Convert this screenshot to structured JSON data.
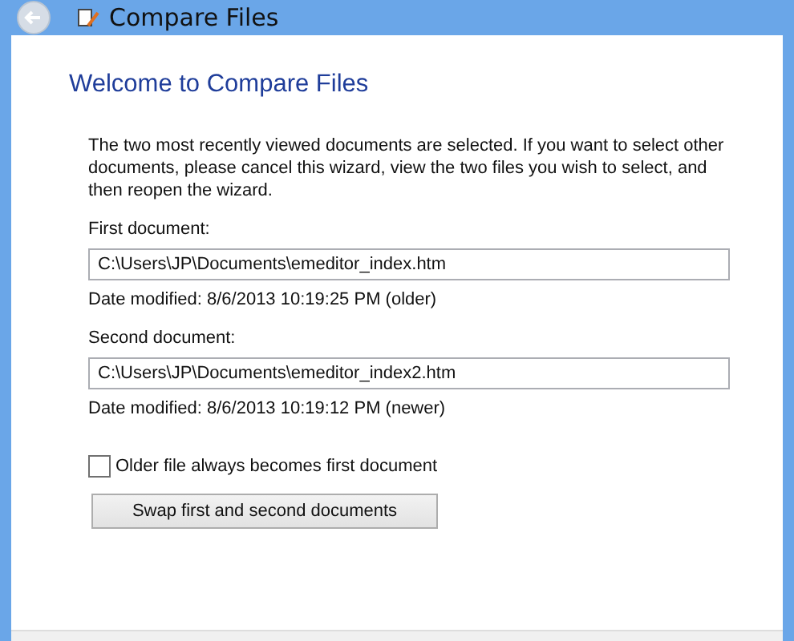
{
  "window": {
    "title": "Compare Files"
  },
  "heading": "Welcome to Compare Files",
  "intro": "The two most recently viewed documents are selected. If you want to select other documents, please cancel this wizard, view the two files you wish to select, and then reopen the wizard.",
  "documents": [
    {
      "label": "First document:",
      "path": "C:\\Users\\JP\\Documents\\emeditor_index.htm",
      "date": "Date modified: 8/6/2013 10:19:25 PM (older)"
    },
    {
      "label": "Second document:",
      "path": "C:\\Users\\JP\\Documents\\emeditor_index2.htm",
      "date": "Date modified: 8/6/2013 10:19:12 PM (newer)"
    }
  ],
  "older_first": {
    "label": "Older file always becomes first document",
    "checked": false
  },
  "swap_button": "Swap first and second documents"
}
